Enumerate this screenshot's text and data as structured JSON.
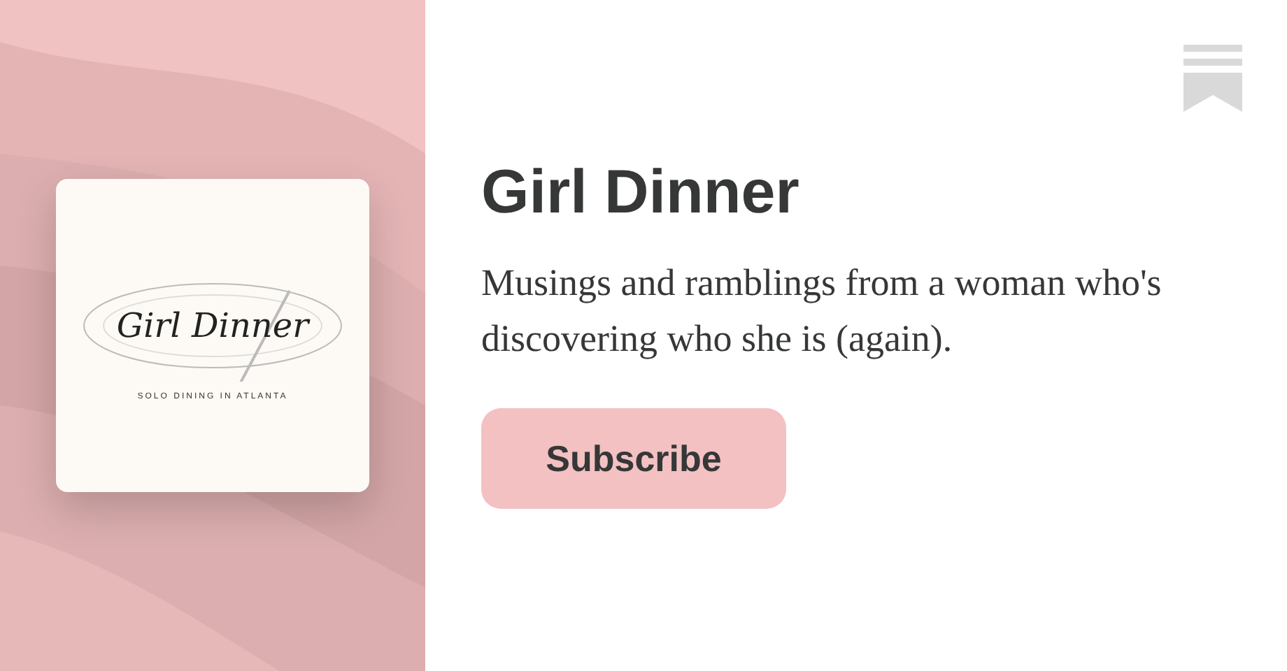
{
  "cover": {
    "logo_title": "Girl Dinner",
    "logo_tagline": "SOLO DINING IN ATLANTA"
  },
  "publication": {
    "title": "Girl Dinner",
    "description": "Musings and ramblings from a woman who's discovering who she is (again)."
  },
  "buttons": [
    "Subscribe"
  ]
}
